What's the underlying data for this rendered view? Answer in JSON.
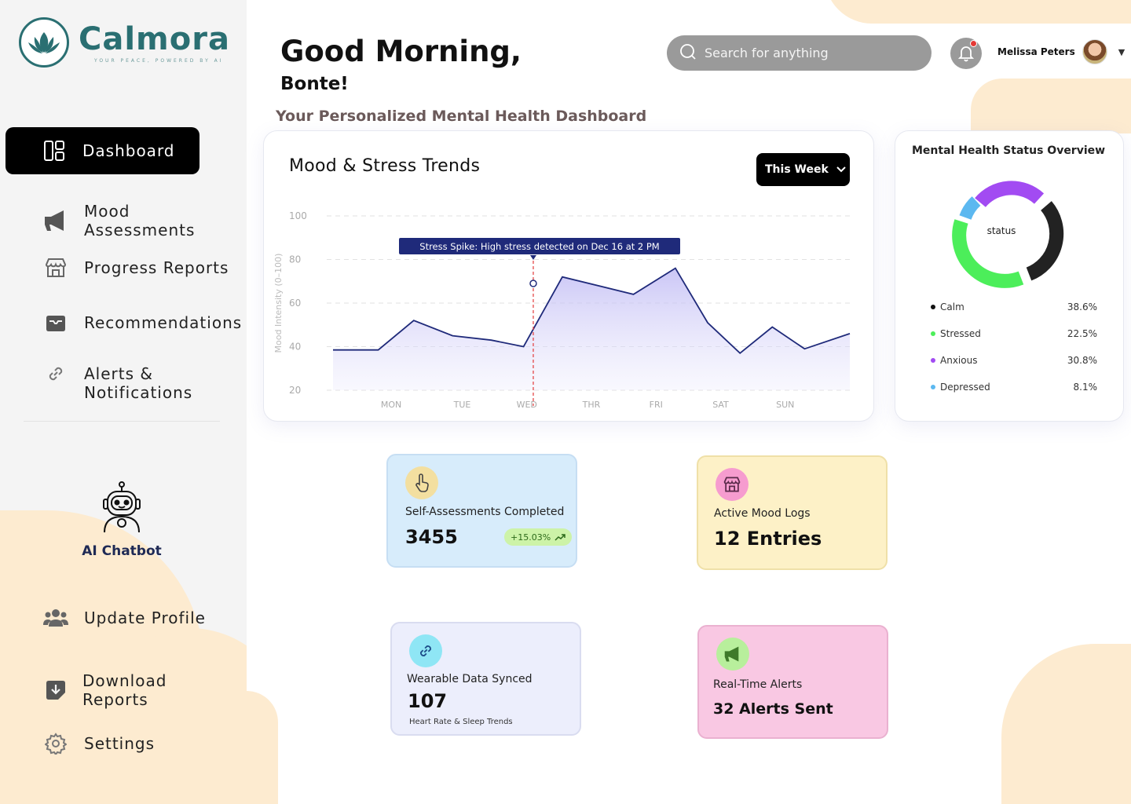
{
  "brand": {
    "name": "Calmora",
    "tagline": "YOUR PEACE, POWERED BY AI"
  },
  "sidebar": {
    "items": [
      {
        "label": "Dashboard",
        "icon": "dashboard-icon",
        "active": true
      },
      {
        "label": "Mood Assessments",
        "icon": "megaphone-icon"
      },
      {
        "label": "Progress Reports",
        "icon": "store-icon"
      },
      {
        "label": "Recommendations",
        "icon": "inbox-icon"
      },
      {
        "label": "Alerts &\nNotifications",
        "icon": "link-icon"
      }
    ],
    "chatbot_label": "AI Chatbot",
    "bottom_items": [
      {
        "label": "Update Profile",
        "icon": "users-icon"
      },
      {
        "label": "Download\nReports",
        "icon": "download-icon"
      },
      {
        "label": "Settings",
        "icon": "gear-icon"
      }
    ]
  },
  "header": {
    "greeting": "Good Morning,",
    "name": "Bonte!",
    "subtitle": "Your Personalized Mental Health Dashboard",
    "search_placeholder": "Search for anything",
    "user_name": "Melissa Peters"
  },
  "trend": {
    "title": "Mood & Stress Trends",
    "range_label": "This Week",
    "annotation": "Stress Spike: High stress detected on Dec 16 at 2 PM"
  },
  "chart_data": {
    "type": "area",
    "title": "Mood & Stress Trends",
    "ylabel": "Mood Intensity (0–100)",
    "xlabel": "",
    "y_ticks": [
      100,
      80,
      60,
      40,
      20
    ],
    "x_ticks": [
      "MON",
      "TUE",
      "WED",
      "THR",
      "FRI",
      "SAT",
      "SUN"
    ],
    "x_tick_pos": [
      0.9,
      2.0,
      3.0,
      4.0,
      5.0,
      6.0,
      7.0
    ],
    "ylim": [
      20,
      100
    ],
    "xlim": [
      0,
      8
    ],
    "series": [
      {
        "x": [
          0,
          0.7,
          1.25,
          1.85,
          2.45,
          2.95,
          3.55,
          4.65,
          5.3,
          5.8,
          6.3,
          6.8,
          7.3,
          8.0
        ],
        "y": [
          38.5,
          38.5,
          52,
          45,
          43,
          40,
          72,
          64,
          76,
          51,
          37,
          49,
          39,
          46
        ]
      }
    ],
    "annotation": {
      "x": 3.1,
      "y": 69,
      "text": "Stress Spike: High stress detected on Dec 16 at 2 PM"
    },
    "grid": true
  },
  "status": {
    "title": "Mental Health Status Overview",
    "center_label": "status",
    "items": [
      {
        "label": "Calm",
        "value": "38.6%",
        "color": "#111111"
      },
      {
        "label": "Stressed",
        "value": "22.5%",
        "color": "#4cee5a"
      },
      {
        "label": "Anxious",
        "value": "30.8%",
        "color": "#a24bf2"
      },
      {
        "label": "Depressed",
        "value": "8.1%",
        "color": "#5cb8f0"
      }
    ]
  },
  "stats": {
    "assessments": {
      "label": "Self-Assessments Completed",
      "value": "3455",
      "trend": "+15.03%"
    },
    "mood_logs": {
      "label": "Active Mood Logs",
      "value": "12 Entries"
    },
    "wearable": {
      "label": "Wearable Data Synced",
      "value": "107",
      "note": "Heart Rate & Sleep Trends"
    },
    "alerts": {
      "label": "Real-Time Alerts",
      "value": "32 Alerts Sent"
    }
  },
  "colors": {
    "accent": "#2a6f72",
    "chart_line": "#1f2a7a",
    "annotation": "#1f2a7a"
  }
}
